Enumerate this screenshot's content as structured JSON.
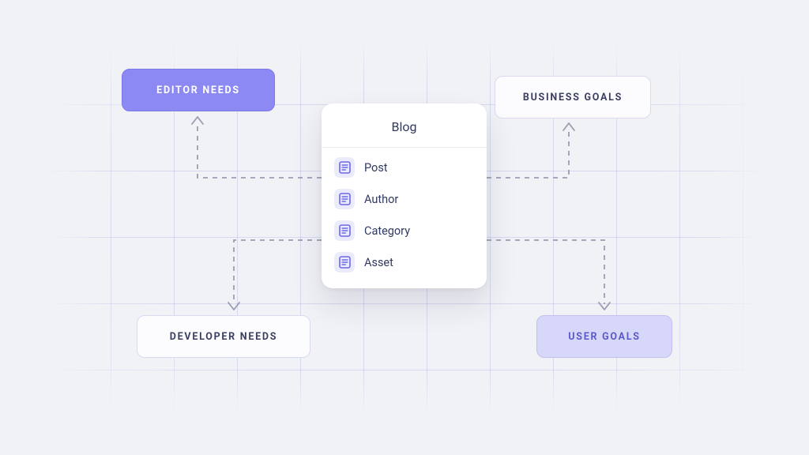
{
  "nodes": {
    "editor_needs": "EDITOR NEEDS",
    "business_goals": "BUSINESS GOALS",
    "developer_needs": "DEVELOPER NEEDS",
    "user_goals": "USER GOALS"
  },
  "panel": {
    "title": "Blog",
    "items": [
      "Post",
      "Author",
      "Category",
      "Asset"
    ]
  },
  "icon_name": "document-icon",
  "colors": {
    "editor_bg": "#8D89F3",
    "user_bg": "#D7D7FA",
    "outline": "#D9DAF2",
    "text_dark": "#2F3A5E",
    "accent": "#6B67E8"
  }
}
